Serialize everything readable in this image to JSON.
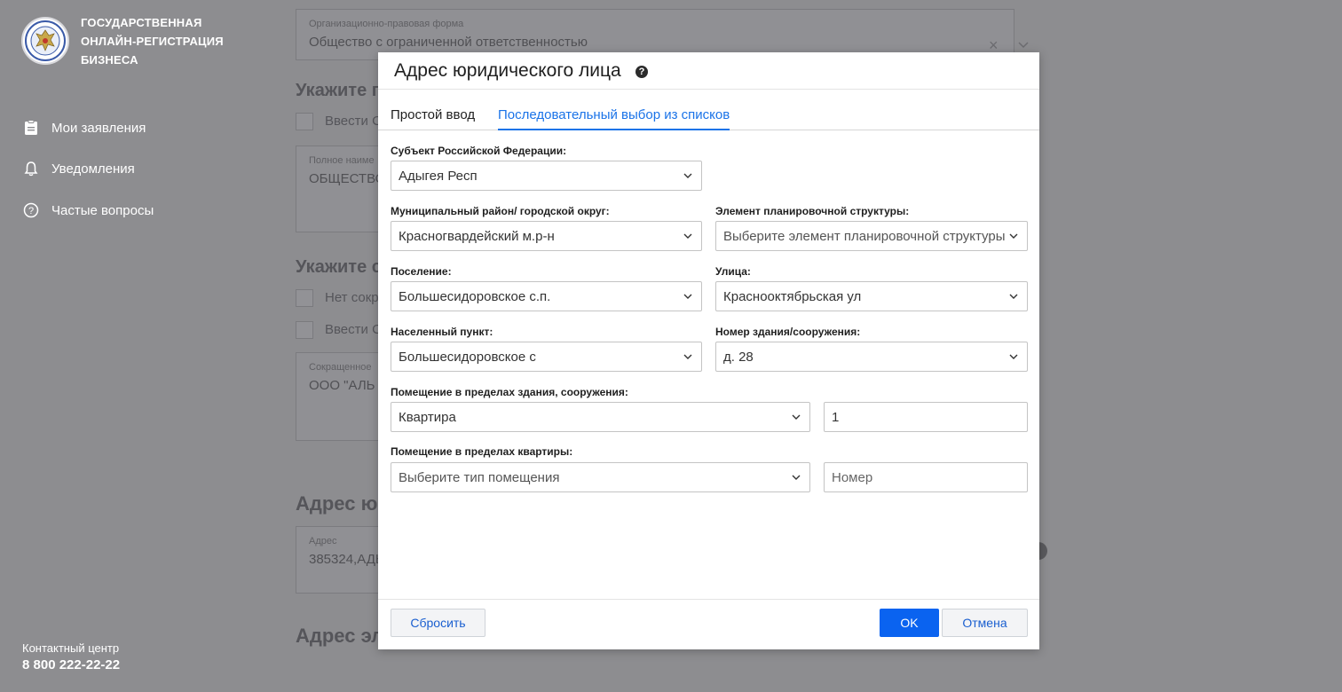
{
  "sidebar": {
    "brand_lines": [
      "ГОСУДАРСТВЕННАЯ",
      "ОНЛАЙН-РЕГИСТРАЦИЯ",
      "БИЗНЕСА"
    ],
    "nav": [
      {
        "label": "Мои заявления",
        "icon": "clipboard-icon"
      },
      {
        "label": "Уведомления",
        "icon": "bell-icon"
      },
      {
        "label": "Частые вопросы",
        "icon": "question-circle-icon"
      }
    ],
    "contact_label": "Контактный центр",
    "contact_phone": "8 800 222-22-22"
  },
  "background_form": {
    "org_form": {
      "label": "Организационно-правовая форма",
      "value": "Общество с ограниченной ответственностью"
    },
    "section1_title": "Укажите п",
    "checkbox1_label": "Ввести С",
    "full_name": {
      "label": "Полное наиме",
      "value": "ОБЩЕСТВО"
    },
    "section2_title": "Укажите с",
    "checkbox2_label": "Нет сокр",
    "checkbox3_label": "Ввести С",
    "short_name": {
      "label": "Сокращенное",
      "value": "ООО \"АЛЬ"
    },
    "address_title": "Адрес ю",
    "address": {
      "label": "Адрес",
      "value": "385324,АДЫ"
    },
    "email_title": "Адрес эл"
  },
  "modal": {
    "title": "Адрес юридического лица",
    "help_glyph": "?",
    "tabs": [
      "Простой ввод",
      "Последовательный выбор из списков"
    ],
    "fields": {
      "subject": {
        "label": "Субъект Российской Федерации:",
        "value": "Адыгея Респ"
      },
      "municipal": {
        "label": "Муниципальный район/ городской округ:",
        "value": "Красногвардейский м.р-н"
      },
      "planning": {
        "label": "Элемент планировочной структуры:",
        "placeholder": "Выберите элемент планировочной структуры"
      },
      "settlement": {
        "label": "Поселение:",
        "value": "Большесидоровское с.п."
      },
      "street": {
        "label": "Улица:",
        "value": "Краснооктябрьская ул"
      },
      "locality": {
        "label": "Населенный пункт:",
        "value": "Большесидоровское с"
      },
      "building": {
        "label": "Номер здания/сооружения:",
        "value": "д. 28"
      },
      "room_in_building": {
        "label": "Помещение в пределах здания, сооружения:",
        "type": "Квартира",
        "number": "1"
      },
      "room_in_flat": {
        "label": "Помещение в пределах квартиры:",
        "type_placeholder": "Выберите тип помещения",
        "number_placeholder": "Номер"
      }
    },
    "buttons": {
      "reset": "Сбросить",
      "ok": "OK",
      "cancel": "Отмена"
    }
  },
  "colors": {
    "accent": "#1a73e8",
    "primary_button": "#0a63f0",
    "overlay": "#8d8d90"
  }
}
